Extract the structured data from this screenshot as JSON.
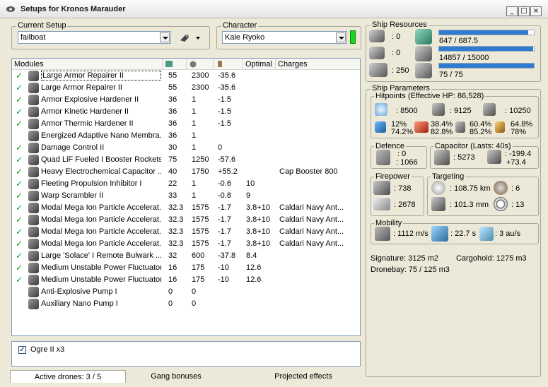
{
  "window": {
    "title": "Setups for Kronos Marauder",
    "minimize_label": "_",
    "maximize_label": "□",
    "close_label": "×"
  },
  "setup": {
    "label": "Current Setup",
    "value": "failboat"
  },
  "character": {
    "label": "Character",
    "value": "Kale Ryoko"
  },
  "modules": {
    "headers": [
      "Modules",
      "",
      "",
      "",
      "Optimal",
      "Charges"
    ],
    "rows": [
      {
        "name": "Large Armor Repairer II",
        "c1": "55",
        "c2": "2300",
        "c3": "-35.6",
        "optimal": "",
        "charges": "",
        "checked": true
      },
      {
        "name": "Large Armor Repairer II",
        "c1": "55",
        "c2": "2300",
        "c3": "-35.6",
        "optimal": "",
        "charges": "",
        "checked": true
      },
      {
        "name": "Armor Explosive Hardener II",
        "c1": "36",
        "c2": "1",
        "c3": "-1.5",
        "optimal": "",
        "charges": "",
        "checked": true
      },
      {
        "name": "Armor Kinetic Hardener II",
        "c1": "36",
        "c2": "1",
        "c3": "-1.5",
        "optimal": "",
        "charges": "",
        "checked": true
      },
      {
        "name": "Armor Thermic Hardener II",
        "c1": "36",
        "c2": "1",
        "c3": "-1.5",
        "optimal": "",
        "charges": "",
        "checked": true
      },
      {
        "name": "Energized Adaptive Nano Membra...",
        "c1": "36",
        "c2": "1",
        "c3": "",
        "optimal": "",
        "charges": "",
        "checked": false
      },
      {
        "name": "Damage Control II",
        "c1": "30",
        "c2": "1",
        "c3": "0",
        "optimal": "",
        "charges": "",
        "checked": true
      },
      {
        "name": "Quad LiF Fueled I Booster Rockets",
        "c1": "75",
        "c2": "1250",
        "c3": "-57.6",
        "optimal": "",
        "charges": "",
        "checked": true
      },
      {
        "name": "Heavy Electrochemical Capacitor ...",
        "c1": "40",
        "c2": "1750",
        "c3": "+55.2",
        "optimal": "",
        "charges": "Cap Booster 800",
        "checked": true
      },
      {
        "name": "Fleeting Propulsion Inhibitor I",
        "c1": "22",
        "c2": "1",
        "c3": "-0.6",
        "optimal": "10",
        "charges": "",
        "checked": true
      },
      {
        "name": "Warp Scrambler II",
        "c1": "33",
        "c2": "1",
        "c3": "-0.8",
        "optimal": "9",
        "charges": "",
        "checked": true
      },
      {
        "name": "Modal Mega Ion Particle Accelerat...",
        "c1": "32.3",
        "c2": "1575",
        "c3": "-1.7",
        "optimal": "3.8+10",
        "charges": "Caldari Navy Ant...",
        "checked": true
      },
      {
        "name": "Modal Mega Ion Particle Accelerat...",
        "c1": "32.3",
        "c2": "1575",
        "c3": "-1.7",
        "optimal": "3.8+10",
        "charges": "Caldari Navy Ant...",
        "checked": true
      },
      {
        "name": "Modal Mega Ion Particle Accelerat...",
        "c1": "32.3",
        "c2": "1575",
        "c3": "-1.7",
        "optimal": "3.8+10",
        "charges": "Caldari Navy Ant...",
        "checked": true
      },
      {
        "name": "Modal Mega Ion Particle Accelerat...",
        "c1": "32.3",
        "c2": "1575",
        "c3": "-1.7",
        "optimal": "3.8+10",
        "charges": "Caldari Navy Ant...",
        "checked": true
      },
      {
        "name": "Large 'Solace' I Remote Bulwark ...",
        "c1": "32",
        "c2": "600",
        "c3": "-37.8",
        "optimal": "8.4",
        "charges": "",
        "checked": true
      },
      {
        "name": "Medium Unstable Power Fluctuator I",
        "c1": "16",
        "c2": "175",
        "c3": "-10",
        "optimal": "12.6",
        "charges": "",
        "checked": true
      },
      {
        "name": "Medium Unstable Power Fluctuator I",
        "c1": "16",
        "c2": "175",
        "c3": "-10",
        "optimal": "12.6",
        "charges": "",
        "checked": true
      },
      {
        "name": "Anti-Explosive Pump I",
        "c1": "0",
        "c2": "0",
        "c3": "",
        "optimal": "",
        "charges": "",
        "checked": false
      },
      {
        "name": "Auxiliary Nano Pump I",
        "c1": "0",
        "c2": "0",
        "c3": "",
        "optimal": "",
        "charges": "",
        "checked": false
      }
    ]
  },
  "drones": {
    "item": "Ogre II x3",
    "checked": true
  },
  "tabs": [
    "Active drones: 3 / 5",
    "Gang bonuses",
    "Projected effects"
  ],
  "resources": {
    "label": "Ship Resources",
    "hardpoints_a": ": 0",
    "hardpoints_b": ": 0",
    "calibration": ": 250",
    "cpu": "647 / 687.5",
    "cpu_fraction": 0.941,
    "power": "14857 / 15000",
    "power_fraction": 0.99,
    "drone_bw": "75 / 75",
    "drone_bw_fraction": 1.0
  },
  "params": {
    "label": "Ship Parameters",
    "hp_label": "Hitpoints (Effective HP: 86,528)",
    "shield_hp": ": 8500",
    "armor_hp": ": 9125",
    "structure_hp": ": 10250",
    "res_shield": [
      "12%",
      "74.2%"
    ],
    "res_armor": [
      "38.4%",
      "82.8%"
    ],
    "res_kin": [
      "60.4%",
      "85.2%"
    ],
    "res_therm": [
      "64.8%",
      "78%"
    ],
    "defence_label": "Defence",
    "defence_a": ": 0",
    "defence_b": ": 1066",
    "capacitor_label": "Capacitor (Lasts: 40s)",
    "cap_value": ": 5273",
    "cap_delta_a": ": -199.4",
    "cap_delta_b": "+73.4",
    "firepower_label": "Firepower",
    "fp_turret": ": 738",
    "fp_drone": ": 2678",
    "targeting_label": "Targeting",
    "range": ": 108.75 km",
    "targets": ": 6",
    "scan_res": ": 101.3 mm",
    "sensor": ": 13",
    "mobility_label": "Mobility",
    "speed": ": 1112 m/s",
    "align": ": 22.7 s",
    "warp": ": 3 au/s",
    "signature": "Signature: 3125 m2",
    "cargohold": "Cargohold: 1275 m3",
    "dronebay": "Dronebay: 75 / 125 m3"
  }
}
